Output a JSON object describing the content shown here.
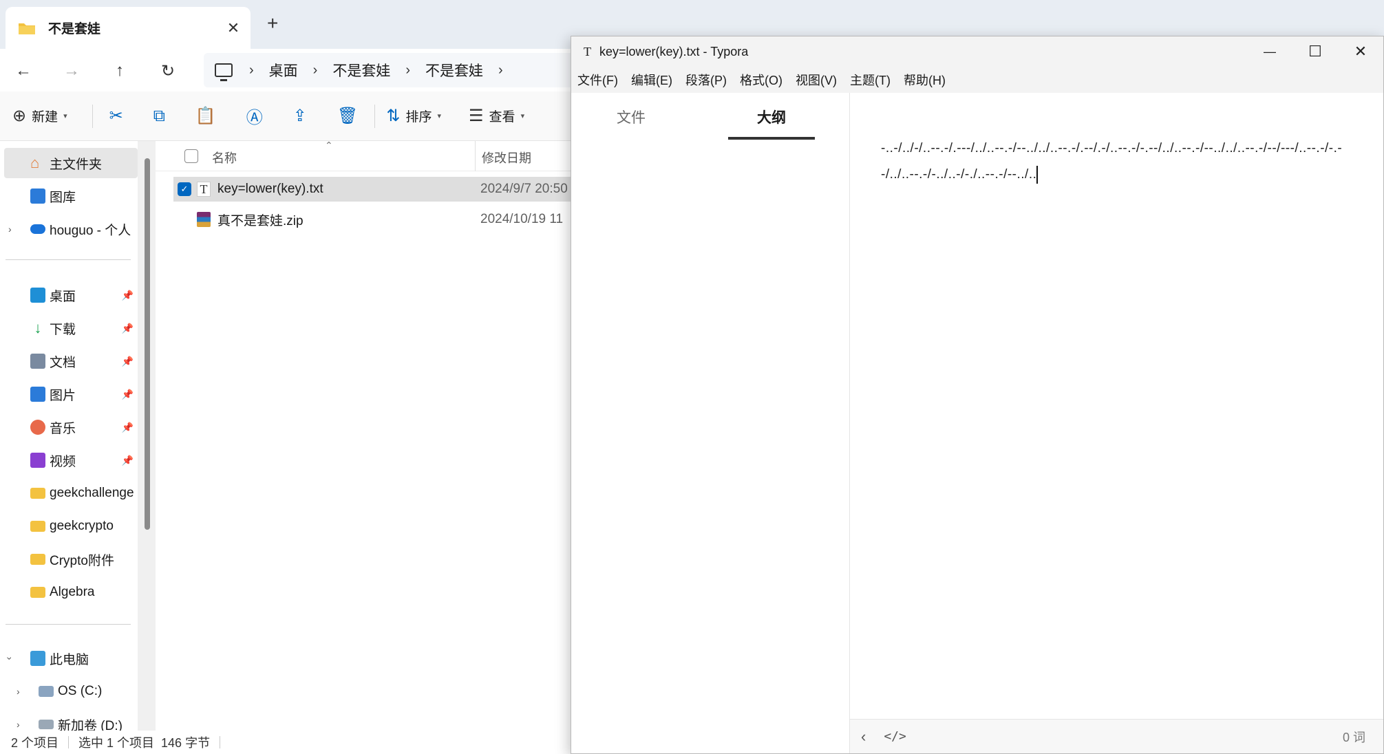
{
  "explorer": {
    "tab_title": "不是套娃",
    "tab_close": "✕",
    "new_tab": "+",
    "nav": {
      "back": "←",
      "forward": "→",
      "up": "↑",
      "refresh": "↻"
    },
    "breadcrumbs": [
      "桌面",
      "不是套娃",
      "不是套娃"
    ],
    "toolbar": {
      "new_label": "新建",
      "sort_label": "排序",
      "view_label": "查看"
    },
    "sidebar": {
      "home": "主文件夹",
      "gallery": "图库",
      "onedrive": "houguo - 个人",
      "quick": [
        {
          "label": "桌面",
          "icon": "desktop-icon",
          "color": "#1e8fd6"
        },
        {
          "label": "下载",
          "icon": "download-icon",
          "color": "#1aa150"
        },
        {
          "label": "文档",
          "icon": "documents-icon",
          "color": "#7a8aa0"
        },
        {
          "label": "图片",
          "icon": "pictures-icon",
          "color": "#2b7bd9"
        },
        {
          "label": "音乐",
          "icon": "music-icon",
          "color": "#e8694a"
        },
        {
          "label": "视频",
          "icon": "videos-icon",
          "color": "#8a3fd1"
        }
      ],
      "folders": [
        "geekchallenge",
        "geekcrypto",
        "Crypto附件",
        "Algebra"
      ],
      "this_pc": "此电脑",
      "drives": [
        "OS (C:)",
        "新加卷 (D:)"
      ]
    },
    "columns": {
      "name": "名称",
      "modified": "修改日期"
    },
    "files": [
      {
        "name": "key=lower(key).txt",
        "date": "2024/9/7 20:50",
        "type": "txt",
        "selected": true
      },
      {
        "name": "真不是套娃.zip",
        "date": "2024/10/19 11",
        "type": "zip",
        "selected": false
      }
    ],
    "status": {
      "count": "2 个项目",
      "selection": "选中 1 个项目",
      "size": "146 字节"
    }
  },
  "typora": {
    "title": "key=lower(key).txt - Typora",
    "logo": "T",
    "window_buttons": {
      "minimize": "—",
      "maximize": "☐",
      "close": "✕"
    },
    "menu": [
      "文件(F)",
      "编辑(E)",
      "段落(P)",
      "格式(O)",
      "视图(V)",
      "主题(T)",
      "帮助(H)"
    ],
    "side_tabs": {
      "files": "文件",
      "outline": "大纲"
    },
    "content": "-..-/../-/..--.-/.---/../..--.-/--../../..--.-/.--/.-/..--.-/-.--/../..--.-/--../../..--.-/--/---/..--.-/-.--/../..--.-/-../..-/-./..--.-/--../..",
    "footer": {
      "back": "‹",
      "source": "</>",
      "word_count": "0 词"
    }
  },
  "colors": {
    "accent": "#0067c0",
    "folder": "#f3c240",
    "onedrive": "#1a73d9"
  }
}
